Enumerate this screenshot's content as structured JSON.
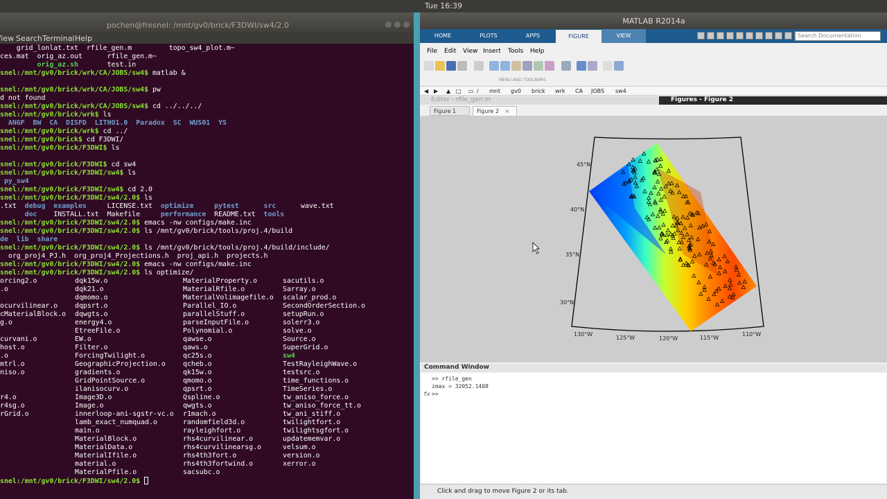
{
  "system": {
    "clock": "Tue 16:39"
  },
  "terminal": {
    "title": "pochen@fresnel: /mnt/gv0/brick/F3DWI/sw4/2.0",
    "menu": [
      "View",
      "Search",
      "Terminal",
      "Help"
    ],
    "lines": [
      [
        {
          "c": "w",
          "t": "    "
        },
        {
          "c": "w",
          "t": "grid_lonlat.txt  rfile_gen.m         topo_sw4_plot.m~"
        }
      ],
      [
        {
          "c": "w",
          "t": "ces.mat  orig_az.out      rfile_gen.m~"
        }
      ],
      [
        {
          "c": "w",
          "t": "         "
        },
        {
          "c": "gb",
          "t": "orig_az.sh"
        },
        {
          "c": "w",
          "t": "       test.in"
        }
      ],
      [
        {
          "c": "g",
          "t": "snel:/mnt/gv0/brick/wrk/CA/JOBS/sw4$"
        },
        {
          "c": "w",
          "t": " matlab &"
        }
      ],
      [
        {
          "c": "w",
          "t": ""
        }
      ],
      [
        {
          "c": "g",
          "t": "snel:/mnt/gv0/brick/wrk/CA/JOBS/sw4$"
        },
        {
          "c": "w",
          "t": " pw"
        }
      ],
      [
        {
          "c": "w",
          "t": "d not found"
        }
      ],
      [
        {
          "c": "g",
          "t": "snel:/mnt/gv0/brick/wrk/CA/JOBS/sw4$"
        },
        {
          "c": "w",
          "t": " cd ../../../"
        }
      ],
      [
        {
          "c": "g",
          "t": "snel:/mnt/gv0/brick/wrk$"
        },
        {
          "c": "w",
          "t": " ls"
        }
      ],
      [
        {
          "c": "b",
          "t": "  ANGF  BW  CA  DISFD  LITHO1.0  Paradox  SC  WUS01  YS"
        }
      ],
      [
        {
          "c": "g",
          "t": "snel:/mnt/gv0/brick/wrk$"
        },
        {
          "c": "w",
          "t": " cd ../"
        }
      ],
      [
        {
          "c": "g",
          "t": "snel:/mnt/gv0/brick$"
        },
        {
          "c": "w",
          "t": " cd F3DWI/"
        }
      ],
      [
        {
          "c": "g",
          "t": "snel:/mnt/gv0/brick/F3DWI$"
        },
        {
          "c": "w",
          "t": " ls"
        }
      ],
      [
        {
          "c": "w",
          "t": ""
        }
      ],
      [
        {
          "c": "g",
          "t": "snel:/mnt/gv0/brick/F3DWI$"
        },
        {
          "c": "w",
          "t": " cd sw4"
        }
      ],
      [
        {
          "c": "g",
          "t": "snel:/mnt/gv0/brick/F3DWI/sw4$"
        },
        {
          "c": "w",
          "t": " ls"
        }
      ],
      [
        {
          "c": "b",
          "t": " py_sw4"
        }
      ],
      [
        {
          "c": "g",
          "t": "snel:/mnt/gv0/brick/F3DWI/sw4$"
        },
        {
          "c": "w",
          "t": " cd 2.0"
        }
      ],
      [
        {
          "c": "g",
          "t": "snel:/mnt/gv0/brick/F3DWI/sw4/2.0$"
        },
        {
          "c": "w",
          "t": " ls"
        }
      ],
      [
        {
          "c": "w",
          "t": ".txt  "
        },
        {
          "c": "b",
          "t": "debug  examples"
        },
        {
          "c": "w",
          "t": "     LICENSE.txt  "
        },
        {
          "c": "b",
          "t": "optimize"
        },
        {
          "c": "w",
          "t": "     "
        },
        {
          "c": "b",
          "t": "pytest"
        },
        {
          "c": "w",
          "t": "      "
        },
        {
          "c": "b",
          "t": "src"
        },
        {
          "c": "w",
          "t": "      wave.txt"
        }
      ],
      [
        {
          "c": "w",
          "t": "      "
        },
        {
          "c": "b",
          "t": "doc"
        },
        {
          "c": "w",
          "t": "    INSTALL.txt  Makefile     "
        },
        {
          "c": "b",
          "t": "performance"
        },
        {
          "c": "w",
          "t": "  README.txt  "
        },
        {
          "c": "b",
          "t": "tools"
        }
      ],
      [
        {
          "c": "g",
          "t": "snel:/mnt/gv0/brick/F3DWI/sw4/2.0$"
        },
        {
          "c": "w",
          "t": " emacs -nw configs/make.inc"
        }
      ],
      [
        {
          "c": "g",
          "t": "snel:/mnt/gv0/brick/F3DWI/sw4/2.0$"
        },
        {
          "c": "w",
          "t": " ls /mnt/gv0/brick/tools/proj.4/build"
        }
      ],
      [
        {
          "c": "b",
          "t": "de  lib  share"
        }
      ],
      [
        {
          "c": "g",
          "t": "snel:/mnt/gv0/brick/F3DWI/sw4/2.0$"
        },
        {
          "c": "w",
          "t": " ls /mnt/gv0/brick/tools/proj.4/build/include/"
        }
      ],
      [
        {
          "c": "w",
          "t": "  org_proj4_PJ.h  org_proj4_Projections.h  proj_api.h  projects.h"
        }
      ],
      [
        {
          "c": "g",
          "t": "snel:/mnt/gv0/brick/F3DWI/sw4/2.0$"
        },
        {
          "c": "w",
          "t": " emacs -nw configs/make.inc"
        }
      ],
      [
        {
          "c": "g",
          "t": "snel:/mnt/gv0/brick/F3DWI/sw4/2.0$"
        },
        {
          "c": "w",
          "t": " ls optimize/"
        }
      ]
    ],
    "columns": [
      [
        "orcing2.o",
        ".o",
        "",
        "ocurvilinear.o",
        "cMaterialBlock.o",
        "g.o",
        "",
        "curvani.o",
        "host.o",
        ".o",
        "mtrl.o",
        "niso.o",
        "",
        "",
        "r4.o",
        "r4sg.o",
        "rGrid.o"
      ],
      [
        "dqk15w.o",
        "dqk21.o",
        "dqmomo.o",
        "dqpsrt.o",
        "dqwgts.o",
        "energy4.o",
        "EtreeFile.o",
        "EW.o",
        "Filter.o",
        "ForcingTwilight.o",
        "GeographicProjection.o",
        "gradients.o",
        "GridPointSource.o",
        "ilanisocurv.o",
        "Image3D.o",
        "Image.o",
        "innerloop-ani-sgstr-vc.o",
        "lamb_exact_numquad.o",
        "main.o",
        "MaterialBlock.o",
        "MaterialData.o",
        "MaterialIfile.o",
        "material.o",
        "MaterialPfile.o"
      ],
      [
        "MaterialProperty.o",
        "MaterialRfile.o",
        "MaterialVolimagefile.o",
        "Parallel_IO.o",
        "parallelStuff.o",
        "parseInputFile.o",
        "Polynomial.o",
        "qawse.o",
        "qaws.o",
        "qc25s.o",
        "qcheb.o",
        "qk15w.o",
        "qmomo.o",
        "qpsrt.o",
        "Qspline.o",
        "qwgts.o",
        "r1mach.o",
        "randomfield3d.o",
        "rayleighfort.o",
        "rhs4curvilinear.o",
        "rhs4curvilinearsg.o",
        "rhs4th3fort.o",
        "rhs4th3fortwind.o",
        "sacsubc.o"
      ],
      [
        "sacutils.o",
        "Sarray.o",
        "scalar_prod.o",
        "SecondOrderSection.o",
        "setupRun.o",
        "solerr3.o",
        "solve.o",
        "Source.o",
        "SuperGrid.o",
        "sw4",
        "TestRayleighWave.o",
        "testsrc.o",
        "time_functions.o",
        "TimeSeries.o",
        "tw_aniso_force.o",
        "tw_aniso_force_tt.o",
        "tw_ani_stiff.o",
        "twilightfort.o",
        "twilightsgfort.o",
        "updatememvar.o",
        "velsum.o",
        "version.o",
        "xerror.o"
      ]
    ],
    "final_prompt": "snel:/mnt/gv0/brick/F3DWI/sw4/2.0$"
  },
  "matlab": {
    "title": "MATLAB R2014a",
    "tabs": [
      "HOME",
      "PLOTS",
      "APPS",
      "FIGURE",
      "VIEW"
    ],
    "active_tab": "FIGURE",
    "search_placeholder": "Search Documentation",
    "menu": [
      "File",
      "Edit",
      "View",
      "Insert",
      "Tools",
      "Help"
    ],
    "toolstrip_label": "MENU AND TOOLBARS",
    "path": [
      "/",
      "mnt",
      "gv0",
      "brick",
      "wrk",
      "CA",
      "JOBS",
      "sw4"
    ],
    "editor_title": "Editor - rfile_gen.m",
    "figures_title": "Figures - Figure 2",
    "figure_tabs": [
      "Figure 1",
      "Figure 2"
    ],
    "active_figure_tab": "Figure 2",
    "map": {
      "lat_labels": [
        "45°N",
        "40°N",
        "35°N",
        "30°N"
      ],
      "lon_labels": [
        "130°W",
        "125°W",
        "120°W",
        "115°W",
        "110°W"
      ],
      "colormap": [
        "#00008f",
        "#0050ff",
        "#00dfff",
        "#60ff9f",
        "#ffff00",
        "#ff9000",
        "#ff2000",
        "#800000"
      ]
    },
    "command_window_title": "Command Window",
    "command_lines": [
      ">> rfile_gen",
      "zmax = 32052.1408",
      ">>"
    ],
    "fx_label": "fx",
    "status": "Click and drag to move Figure 2 or its tab."
  }
}
